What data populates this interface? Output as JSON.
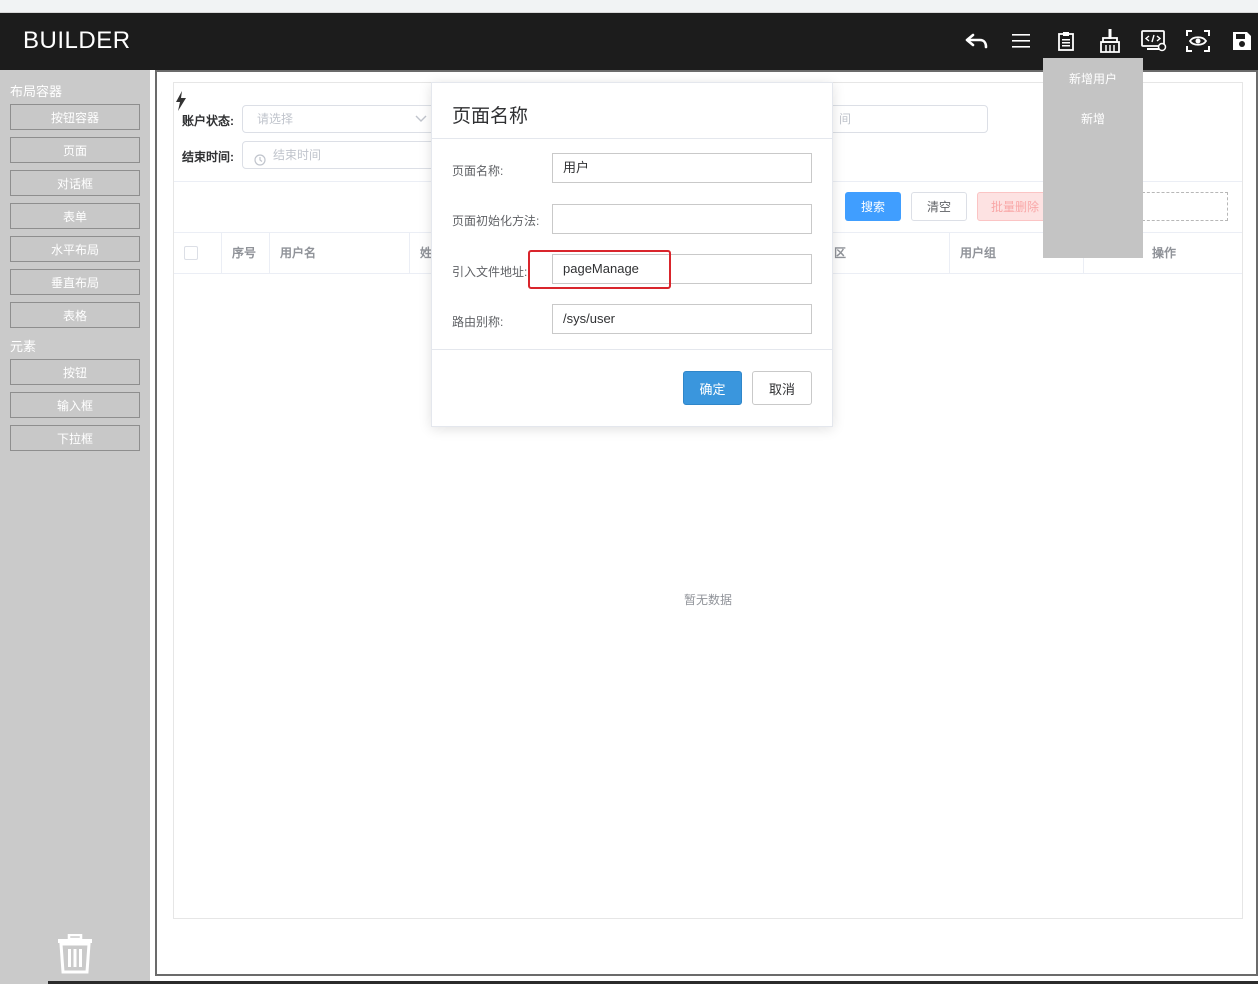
{
  "app": {
    "brand": "BUILDER"
  },
  "toolbar": {
    "icons": [
      "undo-icon",
      "menu-icon",
      "clipboard-icon",
      "broom-icon",
      "code-monitor-icon",
      "preview-eye-icon",
      "save-icon"
    ]
  },
  "hover_menu": {
    "items": [
      "新增用户",
      "新增"
    ]
  },
  "sidebar": {
    "layout_title": "布局容器",
    "layout_items": [
      "按钮容器",
      "页面",
      "对话框",
      "表单",
      "水平布局",
      "垂直布局",
      "表格"
    ],
    "element_title": "元素",
    "element_items": [
      "按钮",
      "输入框",
      "下拉框"
    ]
  },
  "canvas": {
    "filters": {
      "status_label": "账户状态:",
      "status_placeholder": "请选择",
      "end_label": "结束时间:",
      "end_placeholder": "结束时间",
      "right_placeholder": "间"
    },
    "buttons": {
      "search": "搜索",
      "clear": "清空",
      "bulk_delete": "批量删除"
    },
    "table": {
      "columns": [
        "序号",
        "用户名",
        "姓",
        "区",
        "用户组",
        "操作"
      ],
      "empty": "暂无数据"
    }
  },
  "modal": {
    "title": "页面名称",
    "fields": [
      {
        "label": "页面名称:",
        "value": "用户"
      },
      {
        "label": "页面初始化方法:",
        "value": ""
      },
      {
        "label": "引入文件地址:",
        "value": "pageManage"
      },
      {
        "label": "路由别称:",
        "value": "/sys/user"
      }
    ],
    "ok": "确定",
    "cancel": "取消"
  },
  "colors": {
    "topbar": "#1c1c1c",
    "sidebar": "#cacaca",
    "primary": "#409eff",
    "highlight": "#d9252c"
  }
}
